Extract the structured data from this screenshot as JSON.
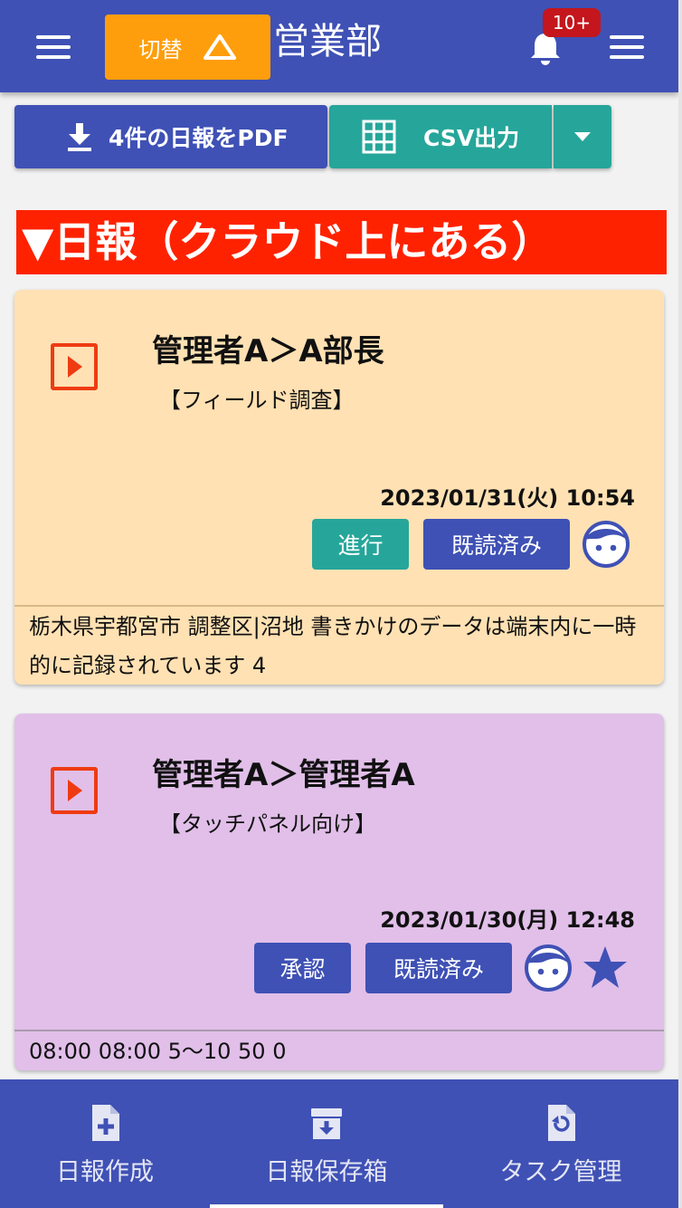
{
  "header": {
    "switch_label": "切替",
    "department": "営業部",
    "notification_badge": "10+",
    "brand_color": "#3f51b5",
    "switch_color": "#ff9e0d"
  },
  "toolbar": {
    "pdf_label": "4件の日報をPDF",
    "csv_label": "CSV出力",
    "icons": [
      "download-icon",
      "grid-icon",
      "dropdown-caret-icon"
    ]
  },
  "section_heading": "▼日報（クラウド上にある）",
  "reports": [
    {
      "title": "管理者A＞A部長",
      "subtitle": "【フィールド調査】",
      "datetime": "2023/01/31(火) 10:54",
      "status_label": "進行",
      "read_label": "既読済み",
      "body": "栃木県宇都宮市 調整区|沼地 書きかけのデータは端末内に一時的に記録されています 4",
      "background": "#ffe1b3",
      "status_color": "#26a69a",
      "starred": false
    },
    {
      "title": "管理者A＞管理者A",
      "subtitle": "【タッチパネル向け】",
      "datetime": "2023/01/30(月) 12:48",
      "status_label": "承認",
      "read_label": "既読済み",
      "body": "08:00 08:00 5〜10 50 0",
      "background": "#e1bfe9",
      "status_color": "#3f51b5",
      "starred": true
    }
  ],
  "bottom_nav": [
    {
      "label": "日報作成",
      "icon": "new-document-icon",
      "active": false
    },
    {
      "label": "日報保存箱",
      "icon": "archive-box-icon",
      "active": true
    },
    {
      "label": "タスク管理",
      "icon": "task-refresh-icon",
      "active": false
    }
  ]
}
